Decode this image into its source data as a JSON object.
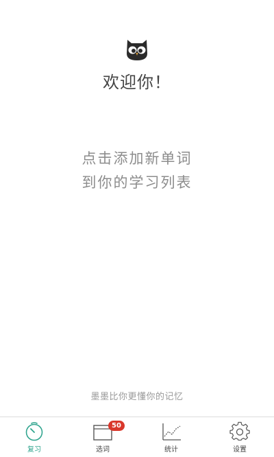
{
  "header": {
    "logo_icon": "owl-icon",
    "welcome": "欢迎你！"
  },
  "main": {
    "prompt_line1": "点击添加新单词",
    "prompt_line2": "到你的学习列表"
  },
  "footer": {
    "slogan": "墨墨比你更懂你的记忆"
  },
  "tabbar": {
    "tabs": [
      {
        "label": "复习",
        "icon": "timer-icon",
        "active": true
      },
      {
        "label": "选词",
        "icon": "word-list-icon",
        "badge": "50"
      },
      {
        "label": "统计",
        "icon": "stats-chart-icon"
      },
      {
        "label": "设置",
        "icon": "gear-icon"
      }
    ]
  },
  "colors": {
    "accent": "#2fa48e",
    "badge": "#d9382c",
    "text_dark": "#444444",
    "text_muted": "#8c8c8c"
  }
}
